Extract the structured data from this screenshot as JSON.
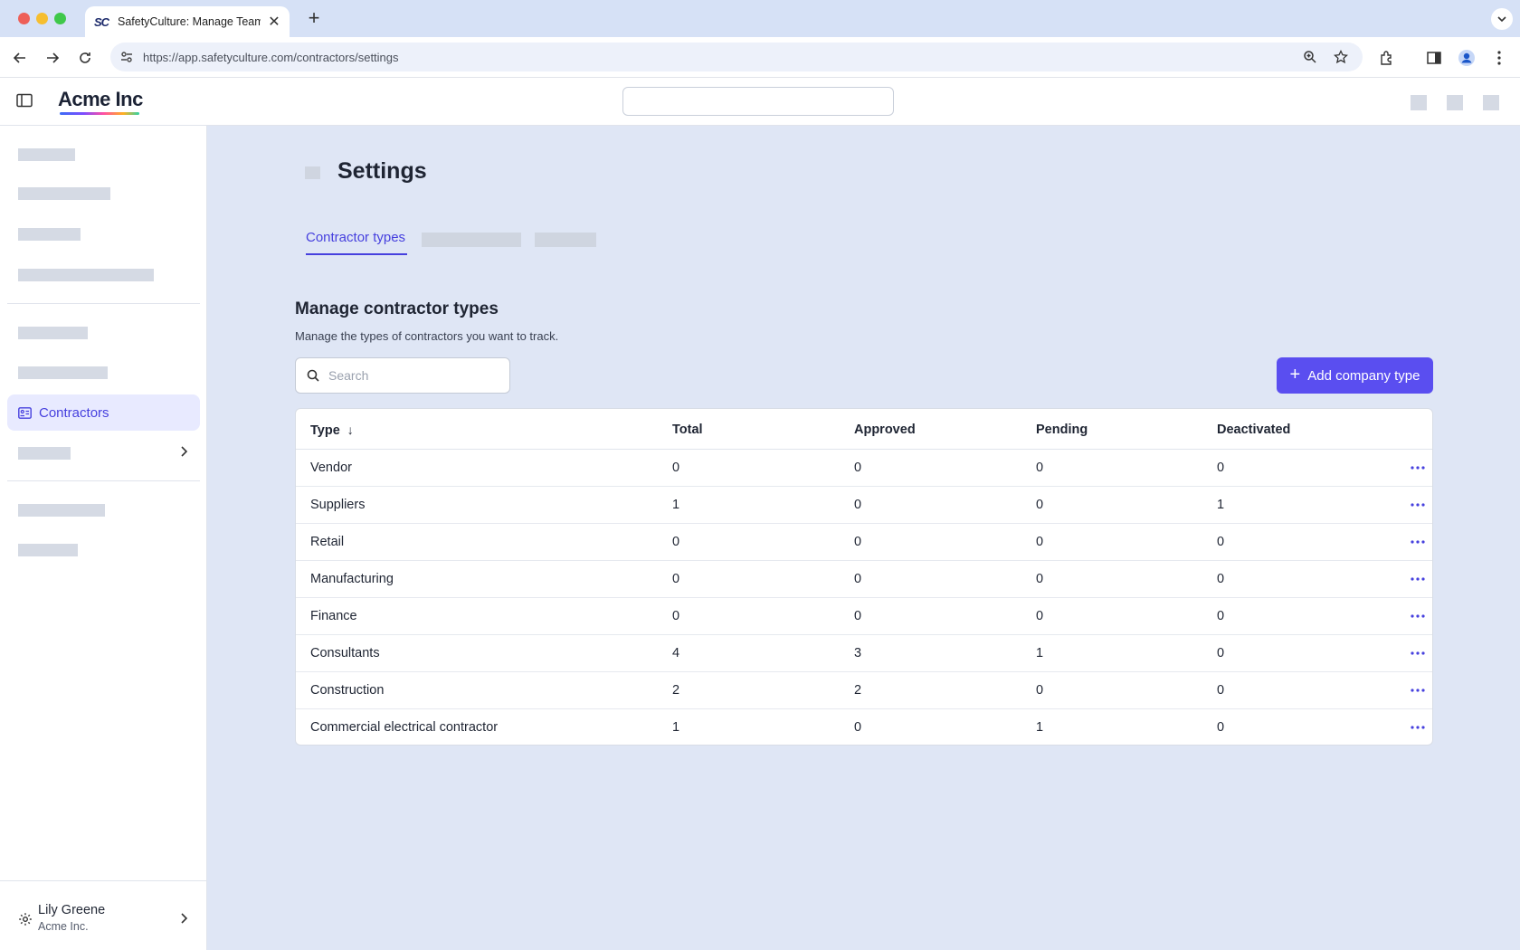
{
  "browser": {
    "tab_title": "SafetyCulture: Manage Teams and...",
    "tab_favicon": "SC",
    "url": "https://app.safetyculture.com/contractors/settings"
  },
  "header": {
    "logo": "Acme Inc"
  },
  "sidebar": {
    "active_item": "Contractors",
    "user_name": "Lily Greene",
    "user_org": "Acme Inc."
  },
  "page": {
    "title": "Settings",
    "active_tab": "Contractor types",
    "section_title": "Manage contractor types",
    "section_description": "Manage the types of contractors you want to track.",
    "search_placeholder": "Search",
    "add_button": "Add company type"
  },
  "table": {
    "columns": [
      "Type",
      "Total",
      "Approved",
      "Pending",
      "Deactivated"
    ],
    "rows": [
      {
        "type": "Vendor",
        "total": "0",
        "approved": "0",
        "pending": "0",
        "deactivated": "0"
      },
      {
        "type": "Suppliers",
        "total": "1",
        "approved": "0",
        "pending": "0",
        "deactivated": "1"
      },
      {
        "type": "Retail",
        "total": "0",
        "approved": "0",
        "pending": "0",
        "deactivated": "0"
      },
      {
        "type": "Manufacturing",
        "total": "0",
        "approved": "0",
        "pending": "0",
        "deactivated": "0"
      },
      {
        "type": "Finance",
        "total": "0",
        "approved": "0",
        "pending": "0",
        "deactivated": "0"
      },
      {
        "type": "Consultants",
        "total": "4",
        "approved": "3",
        "pending": "1",
        "deactivated": "0"
      },
      {
        "type": "Construction",
        "total": "2",
        "approved": "2",
        "pending": "0",
        "deactivated": "0"
      },
      {
        "type": "Commercial electrical contractor",
        "total": "1",
        "approved": "0",
        "pending": "1",
        "deactivated": "0"
      }
    ]
  },
  "colors": {
    "accent": "#5a4ef0",
    "accent_text": "#4640de",
    "page_bg": "#dfe6f5"
  }
}
